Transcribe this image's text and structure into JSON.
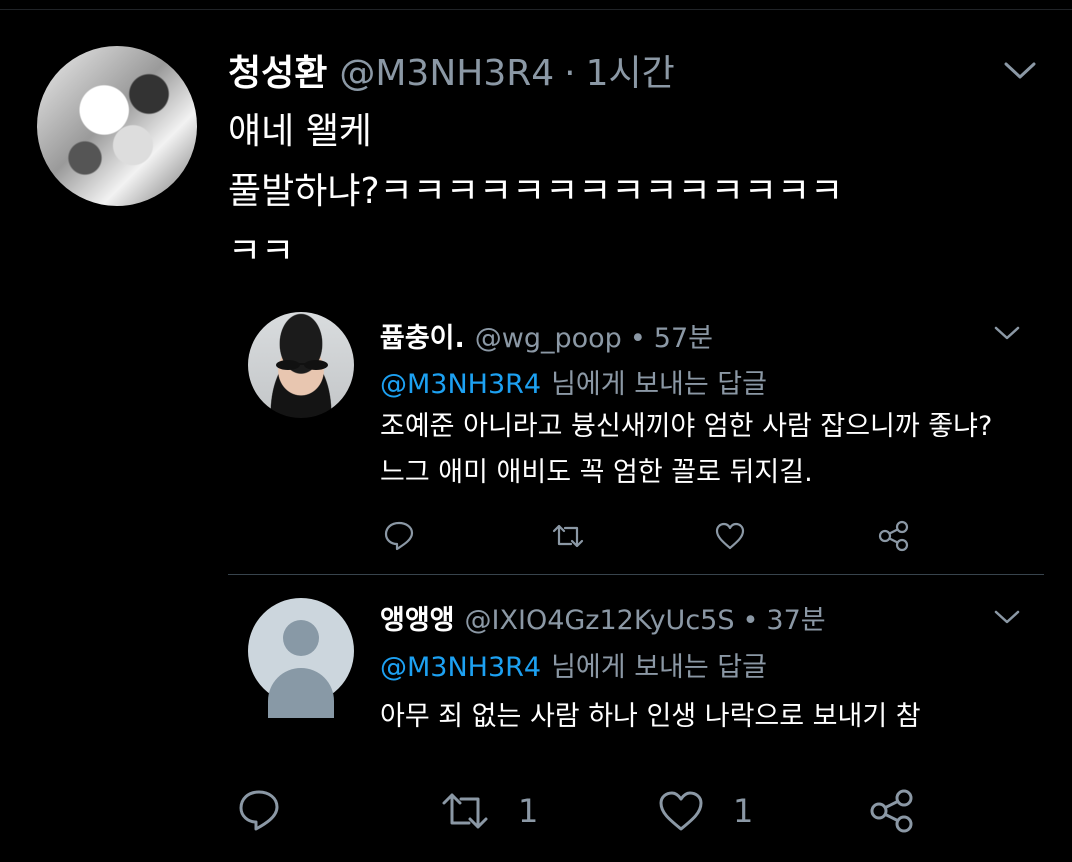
{
  "main": {
    "name": "청성환",
    "handle": "@M3NH3R4",
    "separator": "·",
    "time": "1시간",
    "text": "얘네 왤케\n풀발하냐?ㅋㅋㅋㅋㅋㅋㅋㅋㅋㅋㅋㅋㅋㅋ\nㅋㅋ"
  },
  "replies": [
    {
      "name": "퓹충이.",
      "handle": "@wg_poop",
      "separator": "•",
      "time": "57분",
      "mention": "@M3NH3R4",
      "reply_label": "님에게 보내는 답글",
      "text": "조예준 아니라고 븅신새끼야 엄한 사람 잡으니까 좋냐?\n느그 애미 애비도 꼭 엄한 꼴로 뒤지길."
    },
    {
      "name": "앵앵앵",
      "handle": "@IXIO4Gz12KyUc5S",
      "separator": "•",
      "time": "37분",
      "mention": "@M3NH3R4",
      "reply_label": "님에게 보내는 답글",
      "text": "아무 죄 없는 사람 하나 인생 나락으로 보내기 참"
    }
  ],
  "actions": {
    "retweet_count": "1",
    "like_count": "1"
  },
  "colors": {
    "background": "#000000",
    "secondary_text": "#8b98a5",
    "mention": "#1da1f2",
    "divider": "#38444d"
  },
  "icons": [
    "chevron-down-icon",
    "reply-icon",
    "retweet-icon",
    "like-icon",
    "share-icon"
  ]
}
